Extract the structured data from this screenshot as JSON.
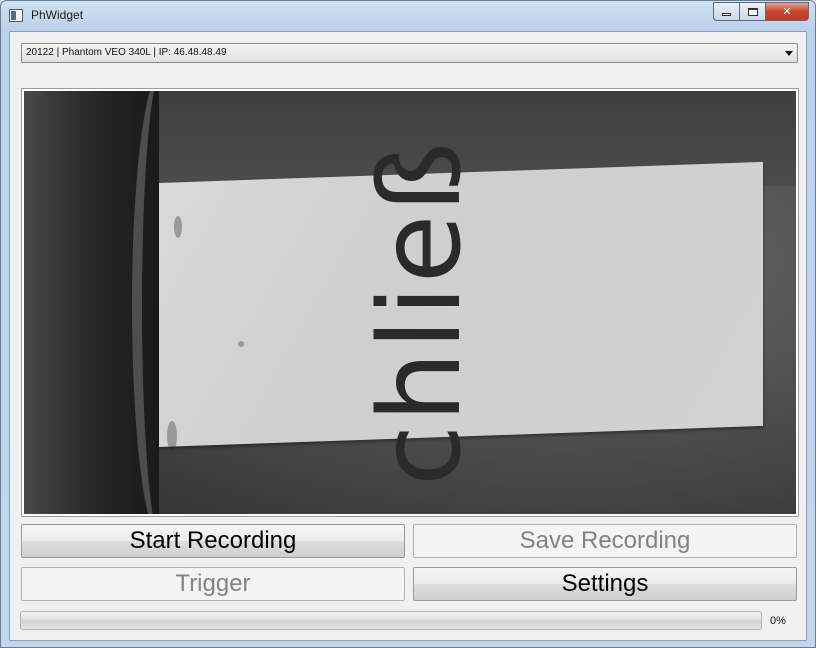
{
  "window": {
    "title": "PhWidget",
    "caption_buttons": {
      "minimize": "",
      "maximize": "",
      "close": "✕"
    }
  },
  "camera_select": {
    "selected": "20122 | Phantom VEO 340L | IP: 46.48.48.49"
  },
  "preview": {
    "image_text": "chließ"
  },
  "buttons": {
    "start_recording": "Start Recording",
    "save_recording": "Save Recording",
    "trigger": "Trigger",
    "settings": "Settings"
  },
  "progress": {
    "value": 0,
    "label": "0%"
  },
  "colors": {
    "title_bar": "#bcd2ea",
    "client_bg": "#f0f0f0",
    "close_button": "#c8452c",
    "disabled_text": "#838383"
  }
}
